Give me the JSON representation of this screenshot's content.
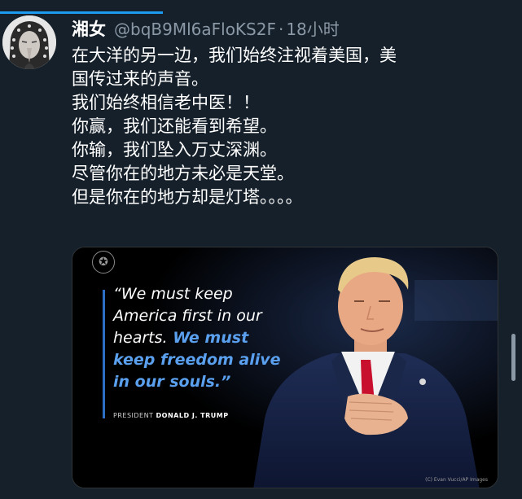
{
  "tweet": {
    "display_name": "湘女",
    "handle": "@bqB9Ml6aFloKS2F",
    "separator": "·",
    "time": "18小时",
    "lines": [
      "在大洋的另一边，我们始终注视着美国，美",
      "国传过来的声音。",
      "我们始终相信老中医！！",
      "你赢，我们还能看到希望。",
      "你输，我们坠入万丈深渊。",
      "尽管你在的地方未必是天堂。",
      "但是你在的地方却是灯塔。。。。"
    ]
  },
  "media": {
    "quote_lines": [
      {
        "text": "“We must keep",
        "style": "white"
      },
      {
        "text": "America first in our",
        "style": "white"
      },
      {
        "text": "hearts.",
        "style": "white",
        "rest": " We must"
      },
      {
        "text": "keep freedom alive",
        "style": "blue"
      },
      {
        "text": "in our souls.”",
        "style": "blue"
      }
    ],
    "attribution_prefix": "PRESIDENT",
    "attribution_name": "DONALD J. TRUMP",
    "credit": "(C) Evan Vucci/AP Images"
  },
  "icons": {
    "seal": "presidential-seal-icon"
  },
  "colors": {
    "background": "#15202b",
    "secondary_text": "#8b98a5",
    "accent_blue": "#1d9bf0",
    "quote_blue": "#5aa0ee"
  }
}
